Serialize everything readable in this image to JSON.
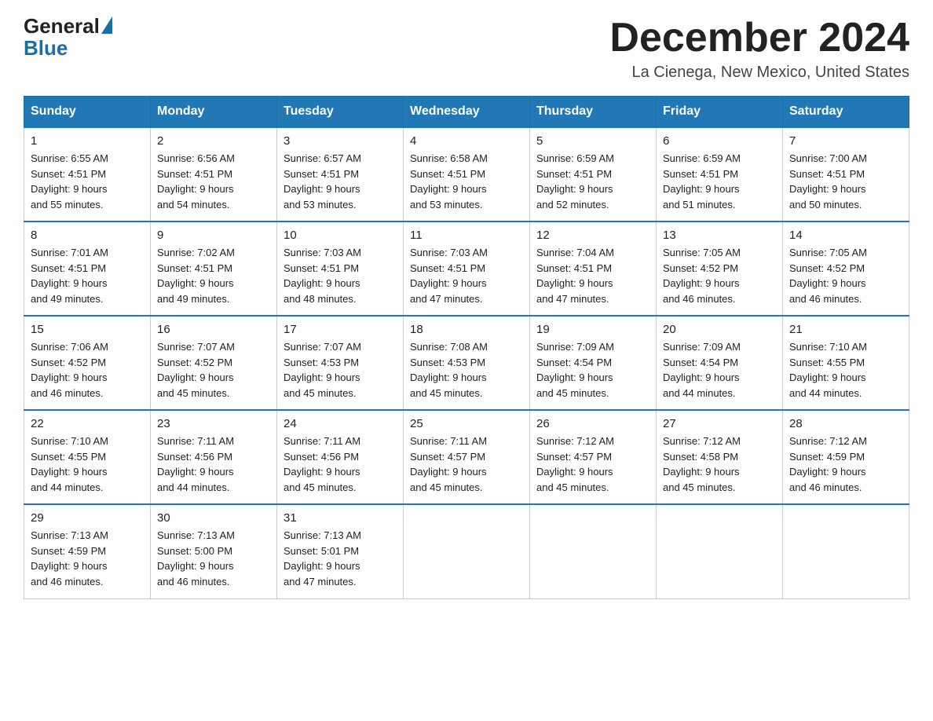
{
  "header": {
    "logo_general": "General",
    "logo_blue": "Blue",
    "title": "December 2024",
    "subtitle": "La Cienega, New Mexico, United States"
  },
  "days_of_week": [
    "Sunday",
    "Monday",
    "Tuesday",
    "Wednesday",
    "Thursday",
    "Friday",
    "Saturday"
  ],
  "weeks": [
    [
      {
        "day": "1",
        "sunrise": "6:55 AM",
        "sunset": "4:51 PM",
        "daylight": "9 hours and 55 minutes."
      },
      {
        "day": "2",
        "sunrise": "6:56 AM",
        "sunset": "4:51 PM",
        "daylight": "9 hours and 54 minutes."
      },
      {
        "day": "3",
        "sunrise": "6:57 AM",
        "sunset": "4:51 PM",
        "daylight": "9 hours and 53 minutes."
      },
      {
        "day": "4",
        "sunrise": "6:58 AM",
        "sunset": "4:51 PM",
        "daylight": "9 hours and 53 minutes."
      },
      {
        "day": "5",
        "sunrise": "6:59 AM",
        "sunset": "4:51 PM",
        "daylight": "9 hours and 52 minutes."
      },
      {
        "day": "6",
        "sunrise": "6:59 AM",
        "sunset": "4:51 PM",
        "daylight": "9 hours and 51 minutes."
      },
      {
        "day": "7",
        "sunrise": "7:00 AM",
        "sunset": "4:51 PM",
        "daylight": "9 hours and 50 minutes."
      }
    ],
    [
      {
        "day": "8",
        "sunrise": "7:01 AM",
        "sunset": "4:51 PM",
        "daylight": "9 hours and 49 minutes."
      },
      {
        "day": "9",
        "sunrise": "7:02 AM",
        "sunset": "4:51 PM",
        "daylight": "9 hours and 49 minutes."
      },
      {
        "day": "10",
        "sunrise": "7:03 AM",
        "sunset": "4:51 PM",
        "daylight": "9 hours and 48 minutes."
      },
      {
        "day": "11",
        "sunrise": "7:03 AM",
        "sunset": "4:51 PM",
        "daylight": "9 hours and 47 minutes."
      },
      {
        "day": "12",
        "sunrise": "7:04 AM",
        "sunset": "4:51 PM",
        "daylight": "9 hours and 47 minutes."
      },
      {
        "day": "13",
        "sunrise": "7:05 AM",
        "sunset": "4:52 PM",
        "daylight": "9 hours and 46 minutes."
      },
      {
        "day": "14",
        "sunrise": "7:05 AM",
        "sunset": "4:52 PM",
        "daylight": "9 hours and 46 minutes."
      }
    ],
    [
      {
        "day": "15",
        "sunrise": "7:06 AM",
        "sunset": "4:52 PM",
        "daylight": "9 hours and 46 minutes."
      },
      {
        "day": "16",
        "sunrise": "7:07 AM",
        "sunset": "4:52 PM",
        "daylight": "9 hours and 45 minutes."
      },
      {
        "day": "17",
        "sunrise": "7:07 AM",
        "sunset": "4:53 PM",
        "daylight": "9 hours and 45 minutes."
      },
      {
        "day": "18",
        "sunrise": "7:08 AM",
        "sunset": "4:53 PM",
        "daylight": "9 hours and 45 minutes."
      },
      {
        "day": "19",
        "sunrise": "7:09 AM",
        "sunset": "4:54 PM",
        "daylight": "9 hours and 45 minutes."
      },
      {
        "day": "20",
        "sunrise": "7:09 AM",
        "sunset": "4:54 PM",
        "daylight": "9 hours and 44 minutes."
      },
      {
        "day": "21",
        "sunrise": "7:10 AM",
        "sunset": "4:55 PM",
        "daylight": "9 hours and 44 minutes."
      }
    ],
    [
      {
        "day": "22",
        "sunrise": "7:10 AM",
        "sunset": "4:55 PM",
        "daylight": "9 hours and 44 minutes."
      },
      {
        "day": "23",
        "sunrise": "7:11 AM",
        "sunset": "4:56 PM",
        "daylight": "9 hours and 44 minutes."
      },
      {
        "day": "24",
        "sunrise": "7:11 AM",
        "sunset": "4:56 PM",
        "daylight": "9 hours and 45 minutes."
      },
      {
        "day": "25",
        "sunrise": "7:11 AM",
        "sunset": "4:57 PM",
        "daylight": "9 hours and 45 minutes."
      },
      {
        "day": "26",
        "sunrise": "7:12 AM",
        "sunset": "4:57 PM",
        "daylight": "9 hours and 45 minutes."
      },
      {
        "day": "27",
        "sunrise": "7:12 AM",
        "sunset": "4:58 PM",
        "daylight": "9 hours and 45 minutes."
      },
      {
        "day": "28",
        "sunrise": "7:12 AM",
        "sunset": "4:59 PM",
        "daylight": "9 hours and 46 minutes."
      }
    ],
    [
      {
        "day": "29",
        "sunrise": "7:13 AM",
        "sunset": "4:59 PM",
        "daylight": "9 hours and 46 minutes."
      },
      {
        "day": "30",
        "sunrise": "7:13 AM",
        "sunset": "5:00 PM",
        "daylight": "9 hours and 46 minutes."
      },
      {
        "day": "31",
        "sunrise": "7:13 AM",
        "sunset": "5:01 PM",
        "daylight": "9 hours and 47 minutes."
      },
      null,
      null,
      null,
      null
    ]
  ],
  "labels": {
    "sunrise": "Sunrise:",
    "sunset": "Sunset:",
    "daylight": "Daylight:"
  }
}
